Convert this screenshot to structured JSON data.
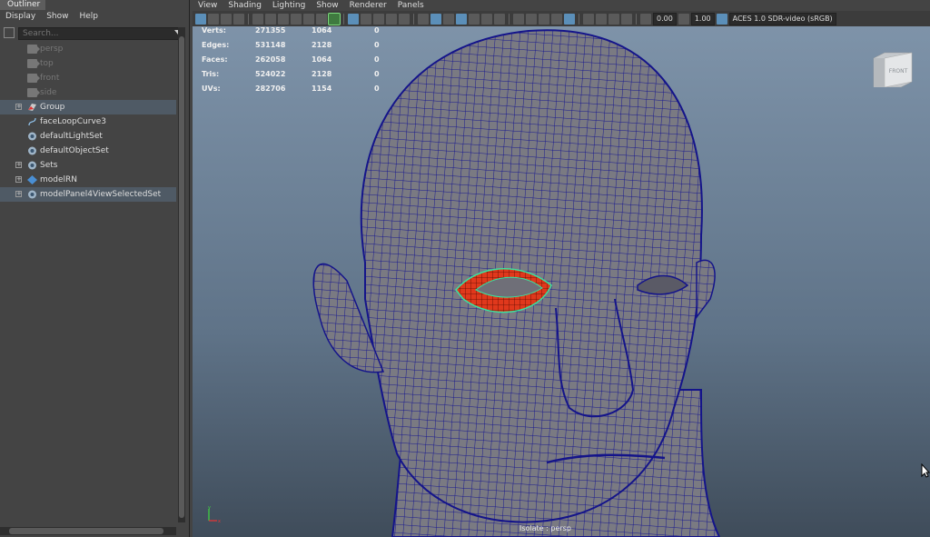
{
  "outliner": {
    "tab_label": "Outliner",
    "menu": [
      "Display",
      "Show",
      "Help"
    ],
    "search_placeholder": "Search...",
    "items": [
      {
        "label": "persp",
        "icon": "camera-icon",
        "dim": true,
        "expandable": false,
        "selected": false
      },
      {
        "label": "top",
        "icon": "camera-icon",
        "dim": true,
        "expandable": false,
        "selected": false
      },
      {
        "label": "front",
        "icon": "camera-icon",
        "dim": true,
        "expandable": false,
        "selected": false
      },
      {
        "label": "side",
        "icon": "camera-icon",
        "dim": true,
        "expandable": false,
        "selected": false
      },
      {
        "label": "Group",
        "icon": "group-icon",
        "dim": false,
        "expandable": true,
        "selected": true
      },
      {
        "label": "faceLoopCurve3",
        "icon": "curve-icon",
        "dim": false,
        "expandable": false,
        "selected": false
      },
      {
        "label": "defaultLightSet",
        "icon": "set-icon",
        "dim": false,
        "expandable": false,
        "selected": false
      },
      {
        "label": "defaultObjectSet",
        "icon": "set-icon",
        "dim": false,
        "expandable": false,
        "selected": false
      },
      {
        "label": "Sets",
        "icon": "set-icon",
        "dim": false,
        "expandable": true,
        "selected": false
      },
      {
        "label": "modelRN",
        "icon": "reference-icon",
        "dim": false,
        "expandable": true,
        "selected": false
      },
      {
        "label": "modelPanel4ViewSelectedSet",
        "icon": "set-icon",
        "dim": false,
        "expandable": true,
        "selected": true
      }
    ]
  },
  "viewport": {
    "menu": [
      "View",
      "Shading",
      "Lighting",
      "Show",
      "Renderer",
      "Panels"
    ],
    "exposure": "0.00",
    "gamma": "1.00",
    "color_space": "ACES 1.0 SDR-video (sRGB)",
    "stats": [
      {
        "label": "Verts:",
        "v1": "271355",
        "v2": "1064",
        "v3": "0"
      },
      {
        "label": "Edges:",
        "v1": "531148",
        "v2": "2128",
        "v3": "0"
      },
      {
        "label": "Faces:",
        "v1": "262058",
        "v2": "1064",
        "v3": "0"
      },
      {
        "label": "Tris:",
        "v1": "524022",
        "v2": "2128",
        "v3": "0"
      },
      {
        "label": "UVs:",
        "v1": "282706",
        "v2": "1154",
        "v3": "0"
      }
    ],
    "viewcube_label": "FRONT",
    "camera_label": "Isolate : persp",
    "colors": {
      "wireframe": "#14148a",
      "selection": "#e0381c",
      "highlight": "#39e39f",
      "background_top": "#7e93a9"
    }
  }
}
